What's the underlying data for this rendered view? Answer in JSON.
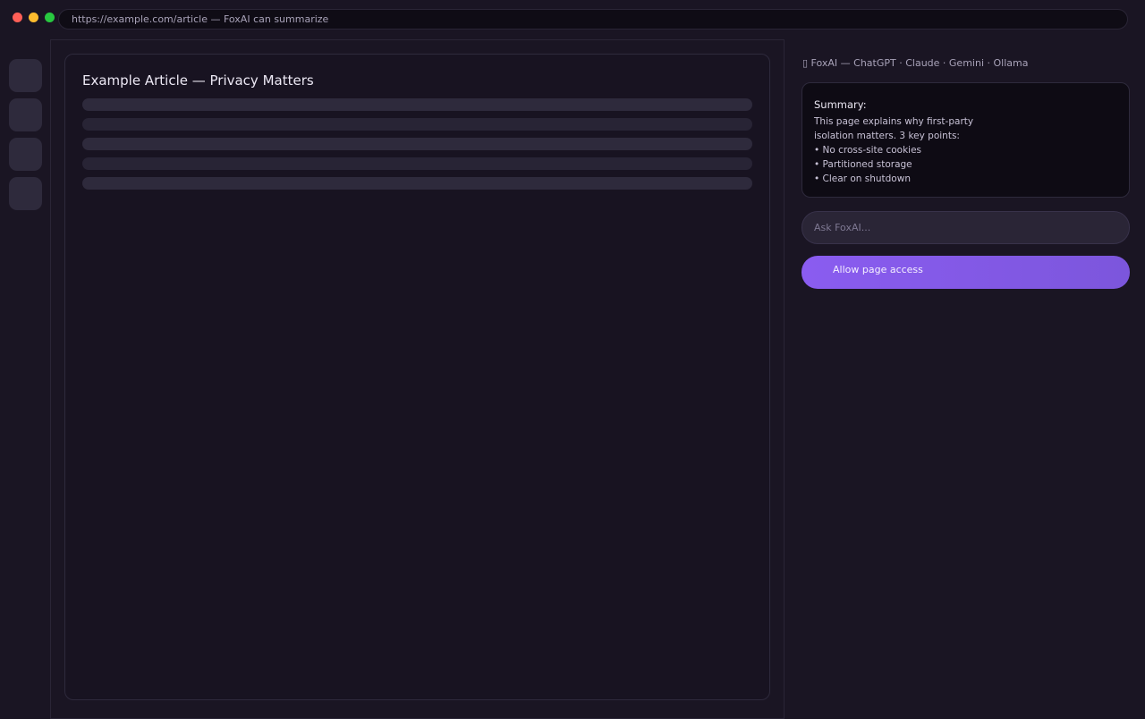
{
  "browser": {
    "url_text": "https://example.com/article — FoxAI can summarize"
  },
  "article": {
    "title": "Example Article — Privacy Matters"
  },
  "sidebar": {
    "header": "▯ FoxAI — ChatGPT · Claude · Gemini · Ollama",
    "summary": {
      "title": "Summary:",
      "lines": [
        "This page explains why first-party",
        "isolation matters. 3 key points:",
        "• No cross-site cookies",
        "• Partitioned storage",
        "• Clear on shutdown"
      ]
    },
    "ask_placeholder": "Ask FoxAI...",
    "allow_button_label": "Allow page access"
  },
  "colors": {
    "accent": "#8a5cf0",
    "background": "#1a1523",
    "window_close": "#ff5f57",
    "window_minimize": "#febc2e",
    "window_zoom": "#28c840"
  }
}
